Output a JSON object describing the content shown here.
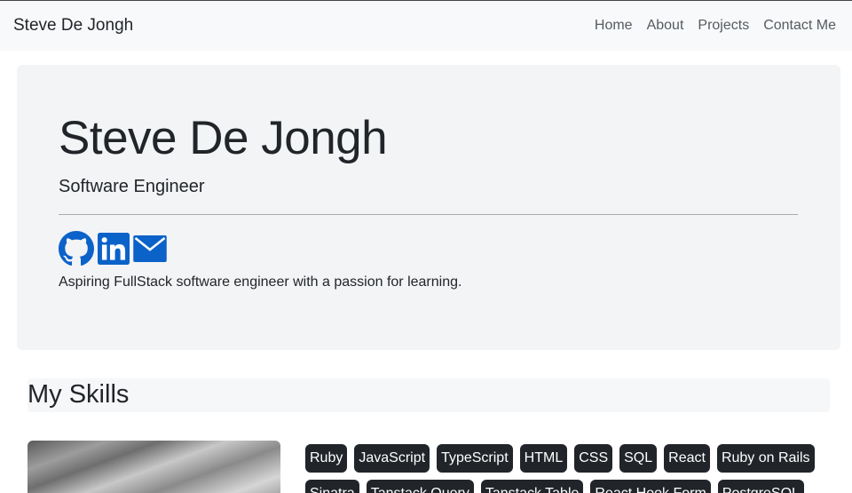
{
  "navbar": {
    "brand": "Steve De Jongh",
    "links": [
      "Home",
      "About",
      "Projects",
      "Contact Me"
    ]
  },
  "hero": {
    "name": "Steve De Jongh",
    "role": "Software Engineer",
    "description": "Aspiring FullStack software engineer with a passion for learning.",
    "socials": [
      "github-icon",
      "linkedin-icon",
      "email-icon"
    ],
    "icon_color": "#0b62c9"
  },
  "skills": {
    "title": "My Skills",
    "badges": [
      "Ruby",
      "JavaScript",
      "TypeScript",
      "HTML",
      "CSS",
      "SQL",
      "React",
      "Ruby on Rails",
      "Sinatra",
      "Tanstack Query",
      "Tanstack Table",
      "React Hook Form",
      "PostgreSQL"
    ]
  }
}
